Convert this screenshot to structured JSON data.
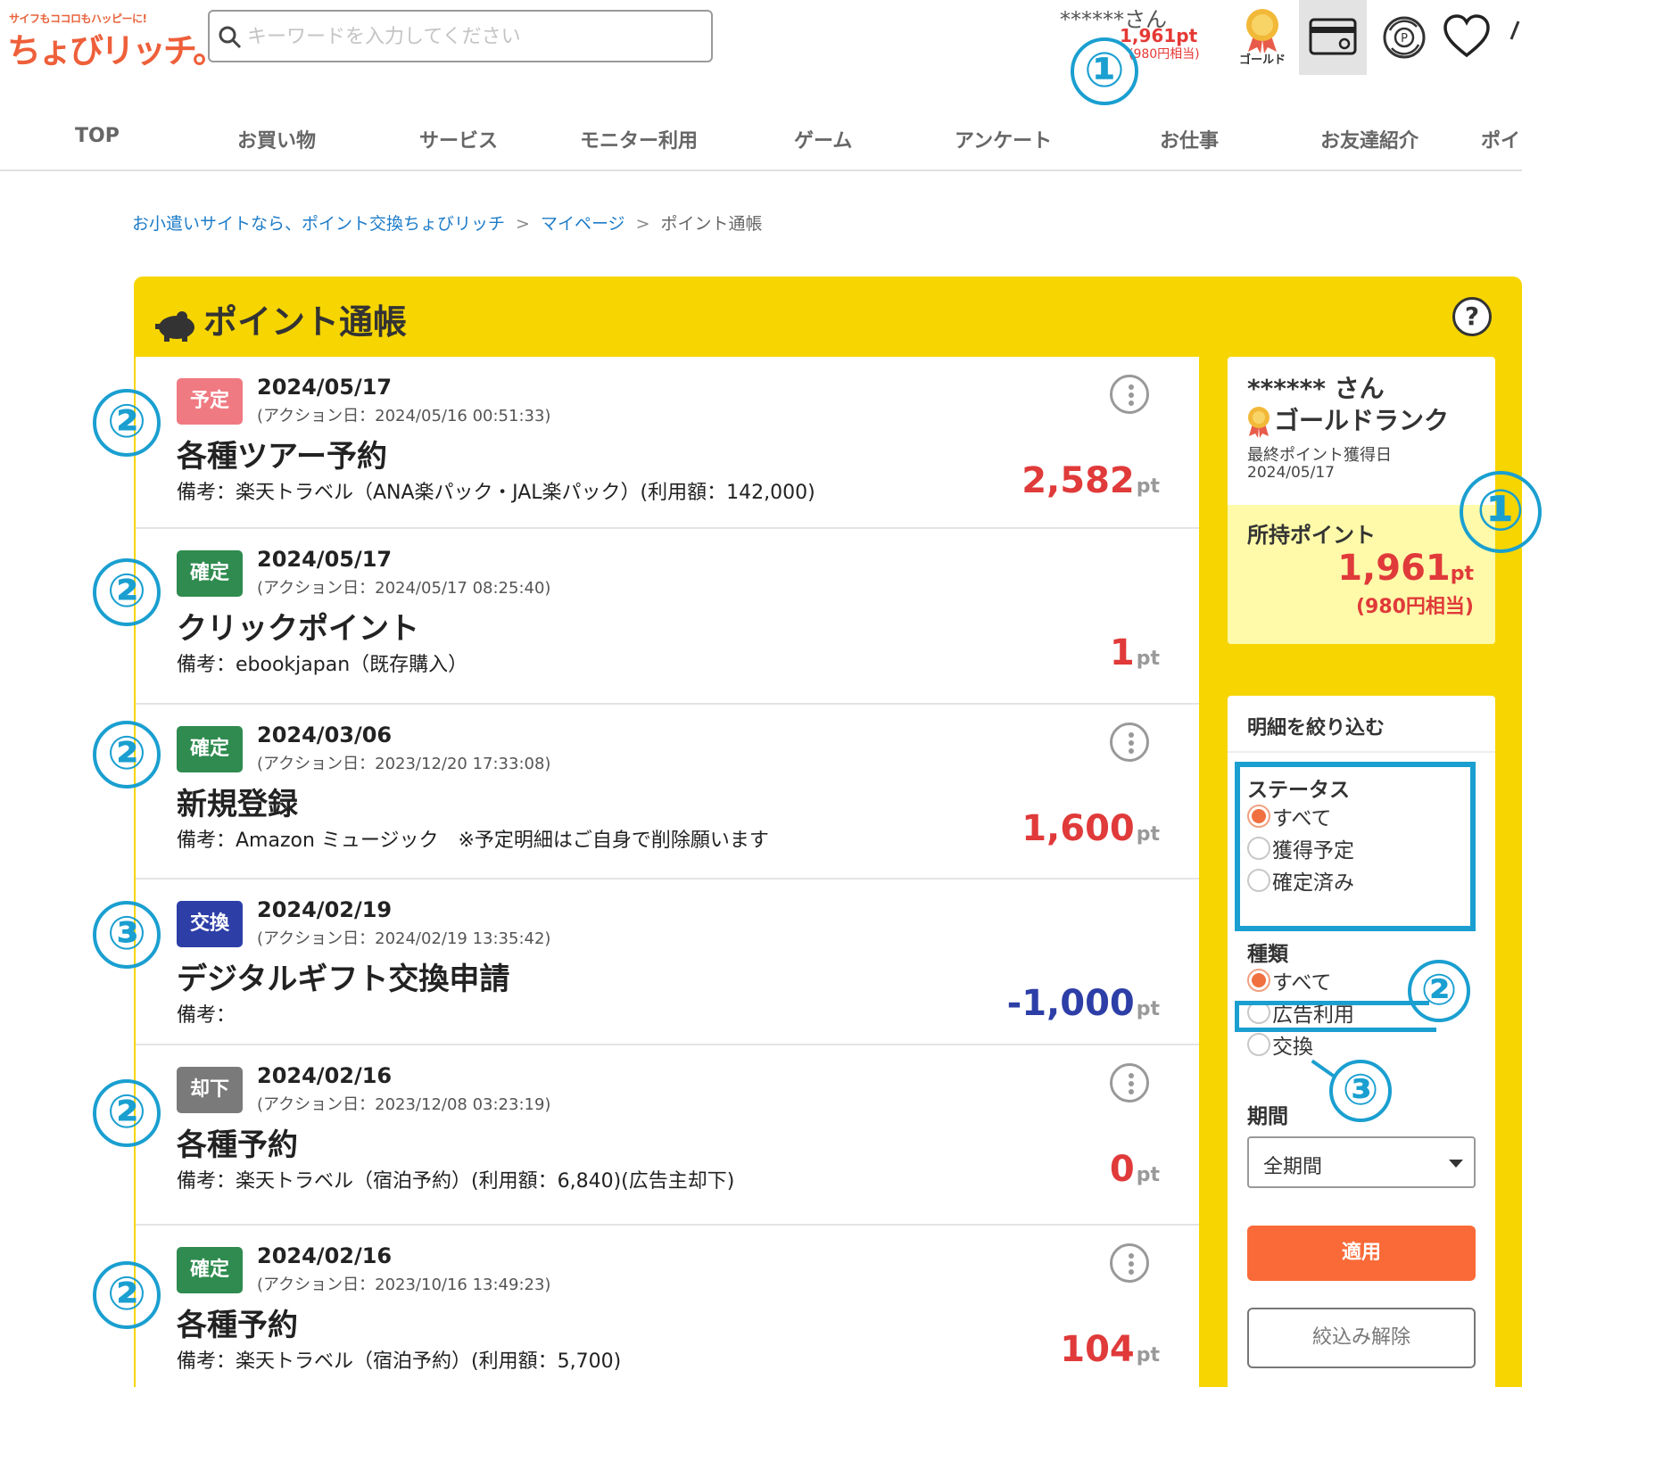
{
  "header": {
    "logo_tagline": "サイフもココロもハッピーに!",
    "logo_main": "ちょびリッチ。",
    "search_placeholder": "キーワードを入力してください",
    "user_name": "******さん",
    "points": "1,961pt",
    "points_yen": "(980円相当)",
    "rank_label": "ゴールド",
    "icons": [
      "wallet-card-icon",
      "point-exchange-icon",
      "heart-icon"
    ]
  },
  "nav": [
    "TOP",
    "お買い物",
    "サービス",
    "モニター利用",
    "ゲーム",
    "アンケート",
    "お仕事",
    "お友達紹介",
    "ポイ"
  ],
  "breadcrumb": [
    "お小遣いサイトなら、ポイント交換ちょびリッチ",
    "マイページ",
    "ポイント通帳"
  ],
  "page_title": "ポイント通帳",
  "entries": [
    {
      "status": "予定",
      "date": "2024/05/17",
      "action": "(アクション日：2024/05/16 00:51:33)",
      "title": "各種ツアー予約",
      "note": "備考：楽天トラベル（ANA楽パック・JAL楽パック）(利用額：142,000)",
      "points": "2,582",
      "unit": "pt"
    },
    {
      "status": "確定",
      "date": "2024/05/17",
      "action": "(アクション日：2024/05/17 08:25:40)",
      "title": "クリックポイント",
      "note": "備考：ebookjapan（既存購入）",
      "points": "1",
      "unit": "pt"
    },
    {
      "status": "確定",
      "date": "2024/03/06",
      "action": "(アクション日：2023/12/20 17:33:08)",
      "title": "新規登録",
      "note": "備考：Amazon ミュージック　※予定明細はご自身で削除願います",
      "points": "1,600",
      "unit": "pt"
    },
    {
      "status": "交換",
      "date": "2024/02/19",
      "action": "(アクション日：2024/02/19 13:35:42)",
      "title": "デジタルギフト交換申請",
      "note": "備考：",
      "points": "-1,000",
      "unit": "pt"
    },
    {
      "status": "却下",
      "date": "2024/02/16",
      "action": "(アクション日：2023/12/08 03:23:19)",
      "title": "各種予約",
      "note": "備考：楽天トラベル（宿泊予約）(利用額：6,840)(広告主却下)",
      "points": "0",
      "unit": "pt"
    },
    {
      "status": "確定",
      "date": "2024/02/16",
      "action": "(アクション日：2023/10/16 13:49:23)",
      "title": "各種予約",
      "note": "備考：楽天トラベル（宿泊予約）(利用額：5,700)",
      "points": "104",
      "unit": "pt"
    }
  ],
  "summary": {
    "user": "****** さん",
    "rank": "ゴールドランク",
    "last_label": "最終ポイント獲得日",
    "last_date": "2024/05/17",
    "balance_label": "所持ポイント",
    "balance": "1,961",
    "unit": "pt",
    "balance_yen": "(980円相当)"
  },
  "filter": {
    "heading": "明細を絞り込む",
    "status_title": "ステータス",
    "status_options": [
      "すべて",
      "獲得予定",
      "確定済み"
    ],
    "type_title": "種類",
    "type_options": [
      "すべて",
      "広告利用",
      "交換"
    ],
    "period_title": "期間",
    "period_value": "全期間",
    "apply": "適用",
    "clear": "絞込み解除"
  },
  "annotations": [
    "①",
    "②",
    "③"
  ],
  "colors": {
    "accent": "#f6d500",
    "points_red": "#e03a3a",
    "annotation": "#1a9fd0",
    "apply": "#f96a38"
  }
}
